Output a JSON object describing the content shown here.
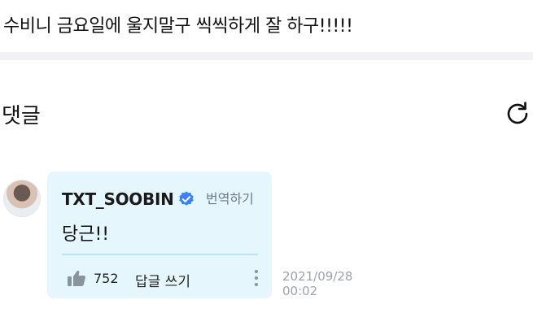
{
  "post": {
    "text": "수비니 금요일에 울지말구 씩씩하게 잘 하구!!!!!"
  },
  "comments_section": {
    "title": "댓글",
    "refresh_icon": "refresh-icon"
  },
  "comment": {
    "author": "TXT_SOOBIN",
    "verified_icon": "verified-badge-icon",
    "translate_label": "번역하기",
    "text": "당근!!",
    "like_icon": "thumbs-up-icon",
    "like_count": "752",
    "reply_label": "답글 쓰기",
    "more_icon": "more-vertical-icon",
    "date": "2021/09/28",
    "time": "00:02"
  },
  "colors": {
    "bubble": "#e6f6fd",
    "verified": "#3b82f6",
    "muted": "#9aa3aa"
  }
}
